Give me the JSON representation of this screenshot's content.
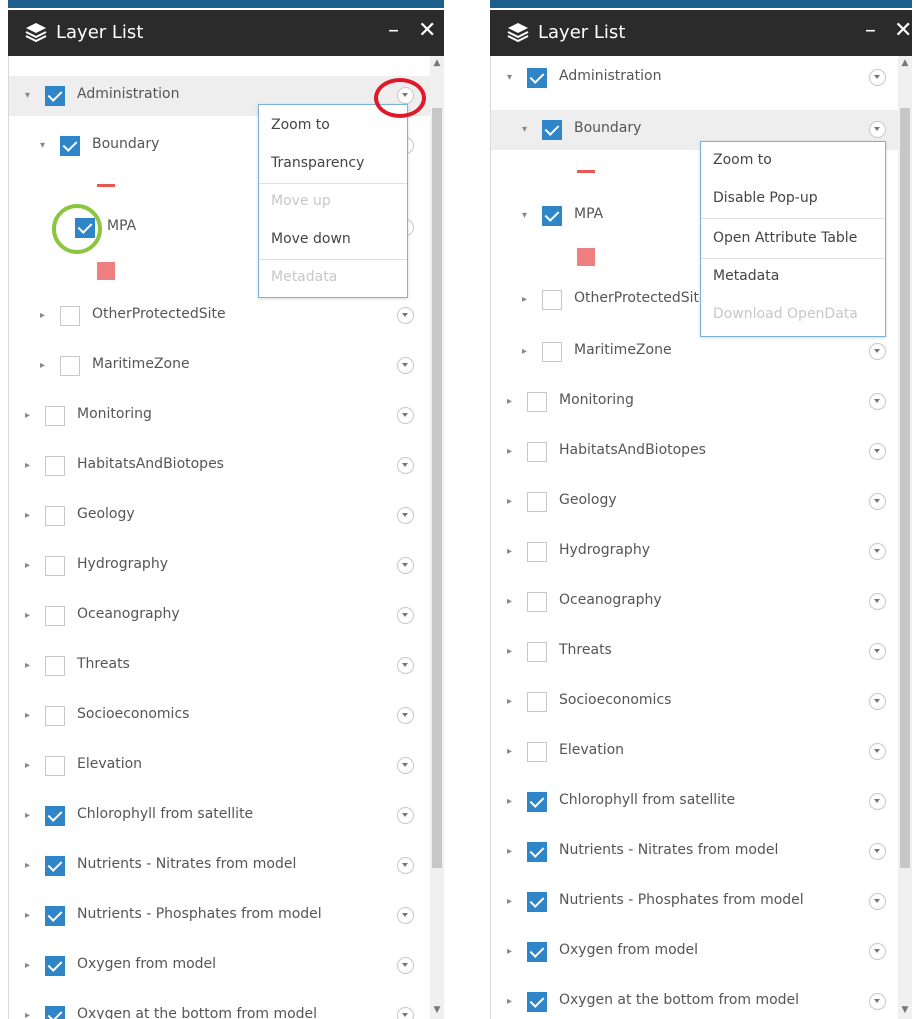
{
  "left_panel": {
    "title": "Layer List",
    "minimize_glyph": "–",
    "close_glyph": "✕",
    "rows": [
      {
        "label": "Administration",
        "checked": true,
        "expander": "▾"
      },
      {
        "label": "Boundary",
        "checked": true,
        "expander": "▾"
      },
      {
        "label": "MPA",
        "checked": true
      },
      {
        "label": "OtherProtectedSite",
        "checked": false,
        "expander": "▸"
      },
      {
        "label": "MaritimeZone",
        "checked": false,
        "expander": "▸"
      },
      {
        "label": "Monitoring",
        "checked": false,
        "expander": "▸"
      },
      {
        "label": "HabitatsAndBiotopes",
        "checked": false,
        "expander": "▸"
      },
      {
        "label": "Geology",
        "checked": false,
        "expander": "▸"
      },
      {
        "label": "Hydrography",
        "checked": false,
        "expander": "▸"
      },
      {
        "label": "Oceanography",
        "checked": false,
        "expander": "▸"
      },
      {
        "label": "Threats",
        "checked": false,
        "expander": "▸"
      },
      {
        "label": "Socioeconomics",
        "checked": false,
        "expander": "▸"
      },
      {
        "label": "Elevation",
        "checked": false,
        "expander": "▸"
      },
      {
        "label": "Chlorophyll from satellite",
        "checked": true,
        "expander": "▸"
      },
      {
        "label": "Nutrients - Nitrates from model",
        "checked": true,
        "expander": "▸"
      },
      {
        "label": "Nutrients - Phosphates from model",
        "checked": true,
        "expander": "▸"
      },
      {
        "label": "Oxygen from model",
        "checked": true,
        "expander": "▸"
      },
      {
        "label": "Oxygen at the bottom from model",
        "checked": true,
        "expander": "▸"
      }
    ],
    "popup": {
      "items": [
        {
          "label": "Zoom to",
          "enabled": true
        },
        {
          "label": "Transparency",
          "enabled": true
        },
        {
          "label": "Move up",
          "enabled": false
        },
        {
          "label": "Move down",
          "enabled": true
        },
        {
          "label": "Metadata",
          "enabled": false
        }
      ]
    }
  },
  "right_panel": {
    "title": "Layer List",
    "minimize_glyph": "–",
    "close_glyph": "✕",
    "rows": [
      {
        "label": "Administration",
        "checked": true,
        "expander": "▾"
      },
      {
        "label": "Boundary",
        "checked": true,
        "expander": "▾"
      },
      {
        "label": "MPA",
        "checked": true,
        "expander": "▾"
      },
      {
        "label": "OtherProtectedSite",
        "checked": false,
        "expander": "▸"
      },
      {
        "label": "MaritimeZone",
        "checked": false,
        "expander": "▸"
      },
      {
        "label": "Monitoring",
        "checked": false,
        "expander": "▸"
      },
      {
        "label": "HabitatsAndBiotopes",
        "checked": false,
        "expander": "▸"
      },
      {
        "label": "Geology",
        "checked": false,
        "expander": "▸"
      },
      {
        "label": "Hydrography",
        "checked": false,
        "expander": "▸"
      },
      {
        "label": "Oceanography",
        "checked": false,
        "expander": "▸"
      },
      {
        "label": "Threats",
        "checked": false,
        "expander": "▸"
      },
      {
        "label": "Socioeconomics",
        "checked": false,
        "expander": "▸"
      },
      {
        "label": "Elevation",
        "checked": false,
        "expander": "▸"
      },
      {
        "label": "Chlorophyll from satellite",
        "checked": true,
        "expander": "▸"
      },
      {
        "label": "Nutrients - Nitrates from model",
        "checked": true,
        "expander": "▸"
      },
      {
        "label": "Nutrients - Phosphates from model",
        "checked": true,
        "expander": "▸"
      },
      {
        "label": "Oxygen from model",
        "checked": true,
        "expander": "▸"
      },
      {
        "label": "Oxygen at the bottom from model",
        "checked": true,
        "expander": "▸"
      }
    ],
    "popup": {
      "items": [
        {
          "label": "Zoom to",
          "enabled": true
        },
        {
          "label": "Disable Pop-up",
          "enabled": true
        },
        {
          "label": "Open Attribute Table",
          "enabled": true
        },
        {
          "label": "Metadata",
          "enabled": true
        },
        {
          "label": "Download OpenData",
          "enabled": false
        }
      ]
    }
  },
  "colors": {
    "checkbox_checked": "#2e86c8",
    "annotation_red": "#e0192a",
    "annotation_green": "#8cc63f",
    "legend_line": "#e8584e",
    "legend_fill": "#f08080"
  }
}
